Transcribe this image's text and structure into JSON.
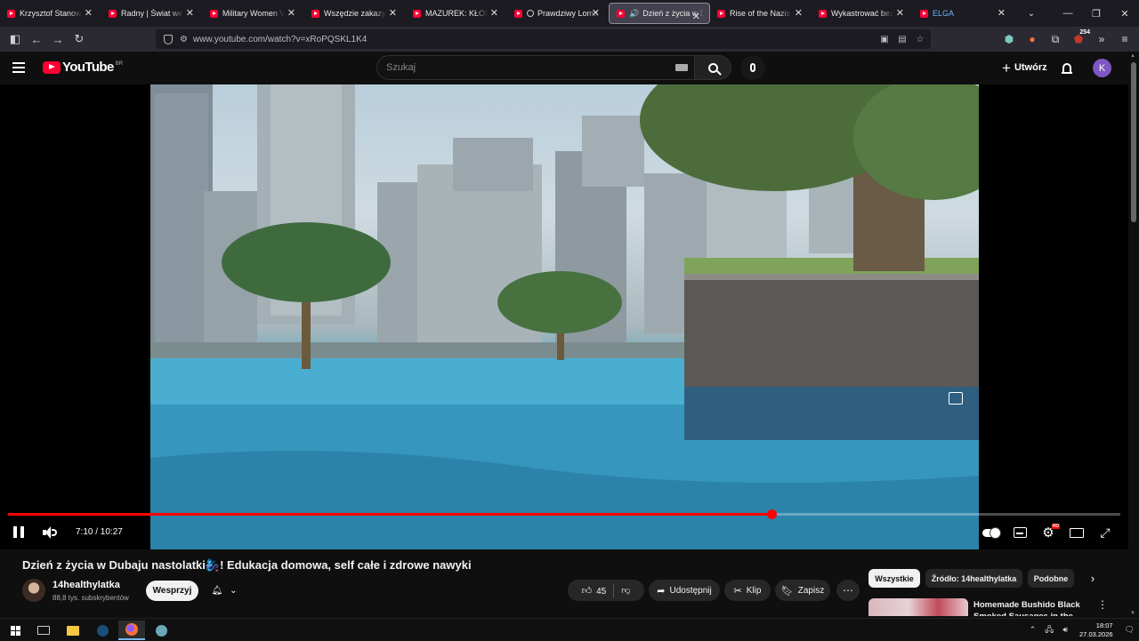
{
  "browser": {
    "tabs": [
      {
        "label": "Krzysztof Stanowski.",
        "icon": "youtube-favicon",
        "active": false
      },
      {
        "label": "Radny | Świat według",
        "icon": "youtube-favicon",
        "active": false
      },
      {
        "label": "Military Women VS S",
        "icon": "youtube-favicon",
        "active": false
      },
      {
        "label": "Wszędzie zakazy i pr",
        "icon": "youtube-favicon",
        "active": false
      },
      {
        "label": "MAZUREK: KŁODZKO",
        "icon": "youtube-favicon",
        "active": false
      },
      {
        "label": "Prawdziwy Lomb",
        "icon": "youtube-favicon",
        "active": false
      },
      {
        "label": "Dzień z życia w D",
        "icon": "youtube-favicon",
        "active": true
      },
      {
        "label": "Rise of the Nazis and",
        "icon": "youtube-favicon",
        "active": false
      },
      {
        "label": "Wykastrować bezdo",
        "icon": "youtube-favicon",
        "active": false
      },
      {
        "label": "ELGA",
        "icon": "youtube-favicon",
        "active": false
      }
    ],
    "url": "www.youtube.com/watch?v=xRoPQSKL1K4",
    "extension_badge": "254"
  },
  "youtube": {
    "logo_text": "YouTube",
    "country_code": "BR",
    "search_placeholder": "Szukaj",
    "create_label": "Utwórz",
    "avatar_letter": "K",
    "accent_color": "#ff0000"
  },
  "player": {
    "current_time": "7:10",
    "duration": "10:27",
    "time_display": "7:10 / 10:27",
    "progress_fraction": 0.686,
    "playing": true
  },
  "video": {
    "title": "Dzień z życia w Dubaju nastolatki🧞‍♀️! Edukacja domowa, self całe i zdrowe nawyki",
    "channel_name": "14healthylatka",
    "subscribers": "88,8 tys. subskrybentów",
    "support_label": "Wesprzyj",
    "like_count": "45",
    "share_label": "Udostępnij",
    "clip_label": "Klip",
    "save_label": "Zapisz"
  },
  "sidebar": {
    "chips": [
      {
        "label": "Wszystkie",
        "active": true
      },
      {
        "label": "Źródło: 14healthylatka",
        "active": false
      },
      {
        "label": "Podobne",
        "active": false
      }
    ],
    "recommendation_title": "Homemade Bushido Black Smoked Sausages in the"
  },
  "taskbar": {
    "time": "18:07",
    "date": "27.03.2026"
  }
}
